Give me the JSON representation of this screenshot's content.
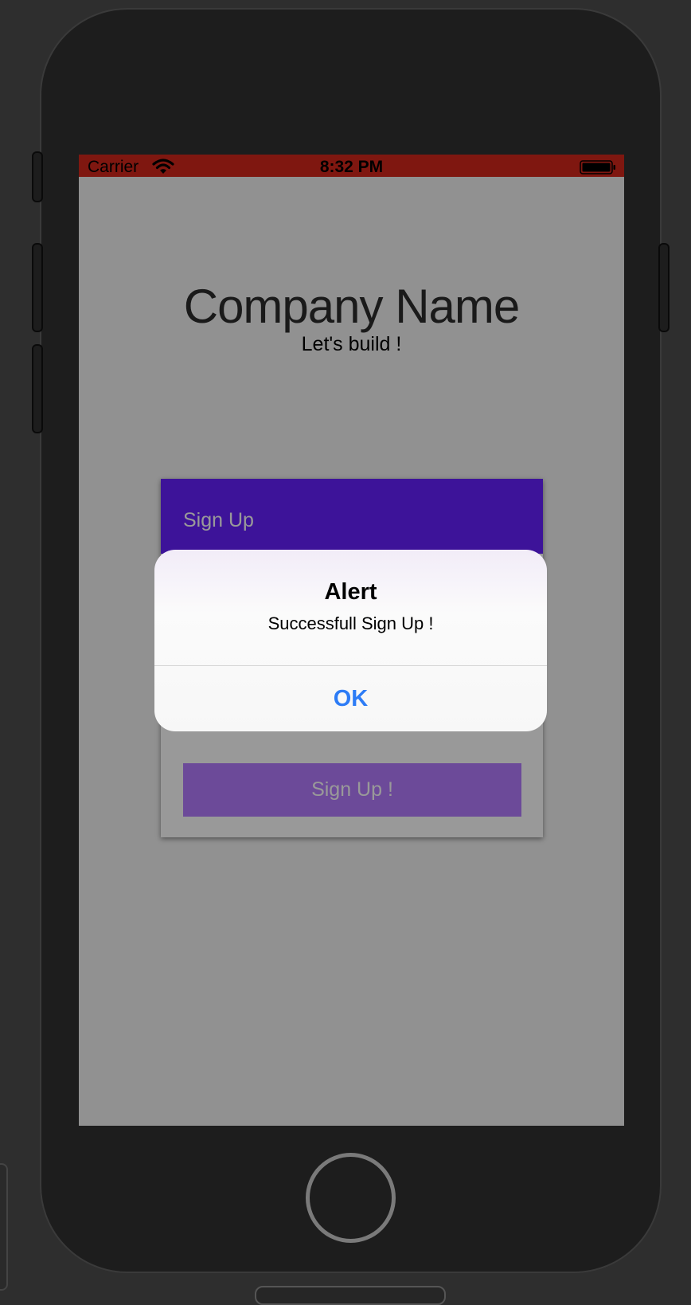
{
  "status_bar": {
    "carrier": "Carrier",
    "time": "8:32 PM",
    "wifi_icon": "wifi-icon",
    "battery_icon": "battery-icon",
    "color": "#d4271c"
  },
  "app": {
    "company_name": "Company Name",
    "tagline": "Let's build !"
  },
  "signup_card": {
    "header_title": "Sign Up",
    "header_color": "#6720ff",
    "button_label": "Sign Up !",
    "button_color": "#b57cff"
  },
  "alert": {
    "title": "Alert",
    "message": "Successfull Sign Up !",
    "ok_label": "OK",
    "ok_color": "#2d7cf6"
  },
  "device": {
    "home_button_icon": "home-button"
  }
}
